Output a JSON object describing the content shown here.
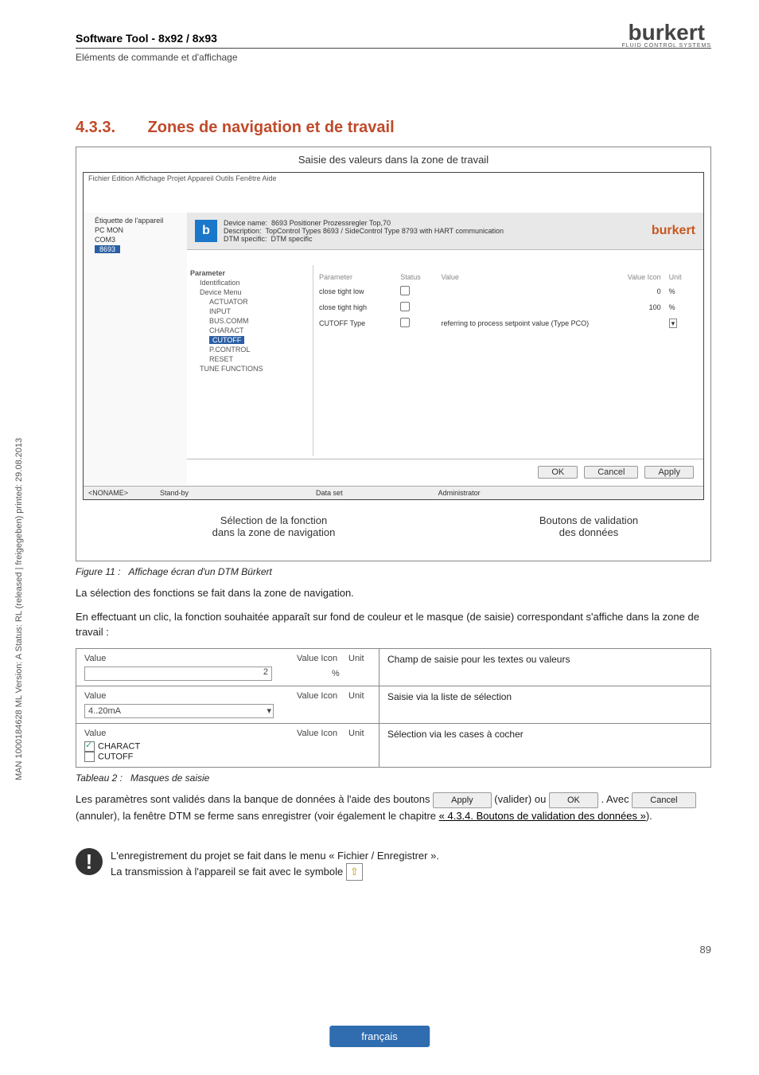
{
  "meta": {
    "side": "MAN 1000184628 ML Version: A Status: RL (released | freigegeben) printed: 29.08.2013",
    "page": "89",
    "lang": "français"
  },
  "header": {
    "title": "Software Tool - 8x92 / 8x93",
    "subtitle": "Eléments de commande et d'affichage",
    "logo": "burkert",
    "logo_sub": "FLUID CONTROL SYSTEMS"
  },
  "section": {
    "num": "4.3.3.",
    "title": "Zones de navigation et de travail"
  },
  "figure": {
    "top_caption": "Saisie des valeurs dans la zone de travail",
    "callout_left_1": "Sélection de la fonction",
    "callout_left_2": "dans la zone de navigation",
    "callout_right_1": "Boutons de validation",
    "callout_right_2": "des données",
    "label_num": "Figure 11 :",
    "label_text": "Affichage écran d'un DTM Bürkert"
  },
  "shot": {
    "title": "Fichier  Edition  Affichage  Projet  Appareil  Outils  Fenêtre  Aide",
    "menubar": "",
    "dev_icon": "b",
    "tree": [
      "Étiquette de l'appareil",
      "PC MON",
      "COM3",
      "8693"
    ],
    "hdr": {
      "l1a": "Device name:",
      "l1b": "8693 Positioner Prozessregler Top,70",
      "l2a": "Description:",
      "l2b": "TopControl Types 8693 / SideControl Type 8793 with HART communication",
      "l3a": "DTM specific:",
      "l3b": "DTM specific"
    },
    "nav": [
      "Parameter",
      "Identification",
      "Device Menu",
      "ACTUATOR",
      "INPUT",
      "BUS.COMM",
      "CHARACT",
      "CUTOFF",
      "P.CONTROL",
      "RESET",
      "TUNE FUNCTIONS"
    ],
    "cols": [
      "Parameter",
      "Status",
      "Value",
      "Value Icon",
      "Unit"
    ],
    "rows": [
      {
        "p": "close tight low",
        "v": "0",
        "u": "%"
      },
      {
        "p": "close tight high",
        "v": "100",
        "u": "%"
      },
      {
        "p": "CUTOFF Type",
        "v": "referring to process setpoint value (Type PCO)",
        "u": ""
      }
    ],
    "buttons": {
      "ok": "OK",
      "cancel": "Cancel",
      "apply": "Apply"
    },
    "status": [
      "<NONAME>",
      "Stand-by",
      "Data set",
      "Administrator"
    ]
  },
  "body": {
    "p1": "La sélection des fonctions se fait dans la zone de navigation.",
    "p2": "En effectuant un clic, la fonction souhaitée apparaît sur fond de couleur et le masque (de saisie) correspondant s'affiche dans la zone de travail :",
    "p3a": "Les paramètres sont validés dans la banque de données à l'aide des boutons ",
    "p3b": " (valider) ou ",
    "p3c": " . Avec ",
    "p3d": " (annuler), la fenêtre DTM se ferme sans enregistrer (voir également le chapitre ",
    "p3link": "« 4.3.4. Boutons de validation des données »",
    "p3e": ")."
  },
  "panels": {
    "col_value": "Value",
    "col_icon": "Value Icon",
    "col_unit": "Unit",
    "r1": {
      "val": "2",
      "unit": "%",
      "desc": "Champ de saisie pour les textes ou valeurs"
    },
    "r2": {
      "val": "4..20mA",
      "desc": "Saisie via la liste de sélection"
    },
    "r3": {
      "opt1": "CHARACT",
      "opt2": "CUTOFF",
      "desc": "Sélection via les cases à cocher"
    },
    "label_num": "Tableau 2 :",
    "label_text": "Masques de saisie"
  },
  "note": {
    "l1": "L'enregistrement du projet se fait dans le menu « Fichier / Enregistrer ».",
    "l2": "La transmission à l'appareil se fait avec le symbole "
  }
}
